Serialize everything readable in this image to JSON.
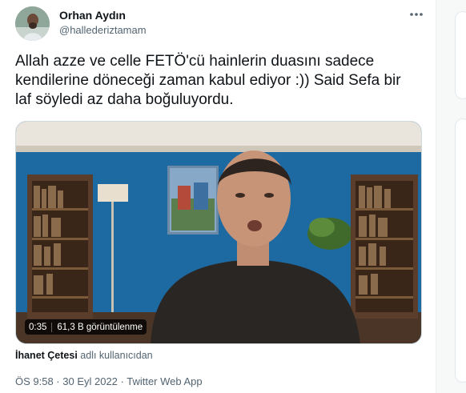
{
  "user": {
    "name": "Orhan Aydın",
    "handle": "@hallederiztamam"
  },
  "tweet": {
    "text": "Allah azze ve celle FETÖ'cü hainlerin duasını sadece kendilerine döneceği zaman kabul ediyor :)) Said Sefa bir laf söyledi az daha boğuluyordu."
  },
  "video": {
    "duration": "0:35",
    "views": "61,3 B görüntülenme"
  },
  "source": {
    "owner": "İhanet Çetesi",
    "suffix": " adlı kullanıcıdan"
  },
  "meta": {
    "timestamp": "ÖS 9:58 · 30 Eyl 2022 · Twitter Web App"
  },
  "icons": {
    "more": "more-horizontal-icon"
  },
  "colors": {
    "text": "#0f1419",
    "secondary": "#536471",
    "border": "#cfd9de"
  }
}
